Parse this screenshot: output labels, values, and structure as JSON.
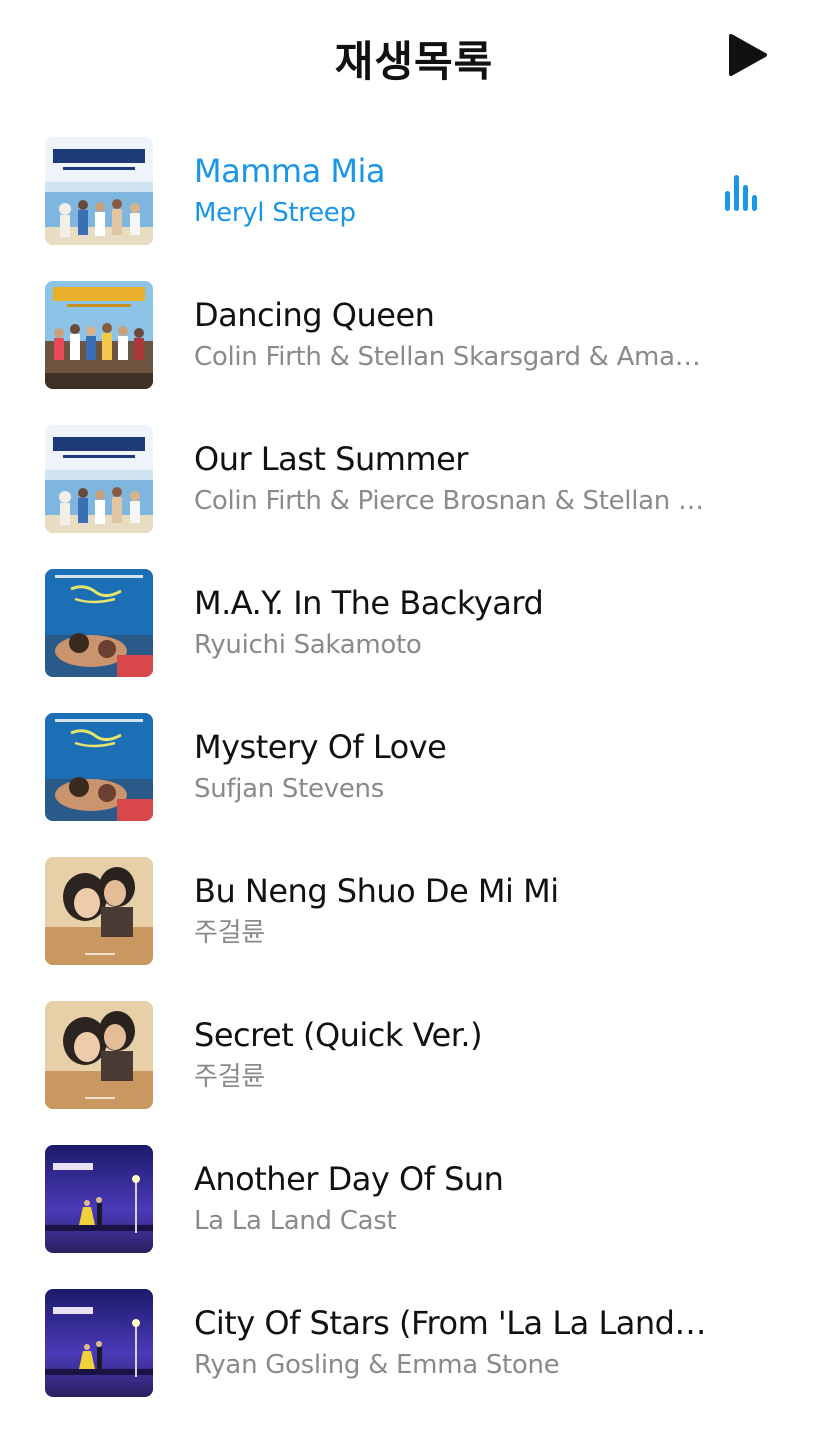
{
  "header": {
    "title": "재생목록",
    "play_icon": "play-icon"
  },
  "colors": {
    "accent": "#1a96e8",
    "title_text": "#111111",
    "subtitle_text": "#8a8a8a"
  },
  "now_playing_icon": "equalizer-icon",
  "playlist": [
    {
      "title": "Mamma Mia",
      "artist": "Meryl Streep",
      "album_art": "mamma-mia-soundtrack-art",
      "playing": true
    },
    {
      "title": "Dancing Queen",
      "artist": "Colin Firth & Stellan Skarsgard & Amanda …",
      "album_art": "mamma-mia-here-we-go-again-art",
      "playing": false
    },
    {
      "title": "Our Last Summer",
      "artist": "Colin Firth & Pierce Brosnan & Stellan Ska…",
      "album_art": "mamma-mia-soundtrack-art",
      "playing": false
    },
    {
      "title": "M.A.Y. In The Backyard",
      "artist": "Ryuichi Sakamoto",
      "album_art": "call-me-by-your-name-art",
      "playing": false
    },
    {
      "title": "Mystery Of Love",
      "artist": "Sufjan Stevens",
      "album_art": "call-me-by-your-name-art",
      "playing": false
    },
    {
      "title": "Bu Neng Shuo De Mi Mi",
      "artist": "주걸륜",
      "album_art": "secret-soundtrack-art",
      "playing": false
    },
    {
      "title": "Secret (Quick Ver.)",
      "artist": "주걸륜",
      "album_art": "secret-soundtrack-art",
      "playing": false
    },
    {
      "title": "Another Day Of Sun",
      "artist": "La La Land Cast",
      "album_art": "la-la-land-art",
      "playing": false
    },
    {
      "title": "City Of Stars (From 'La La Land' S…",
      "artist": "Ryan Gosling & Emma Stone",
      "album_art": "la-la-land-art",
      "playing": false
    }
  ]
}
